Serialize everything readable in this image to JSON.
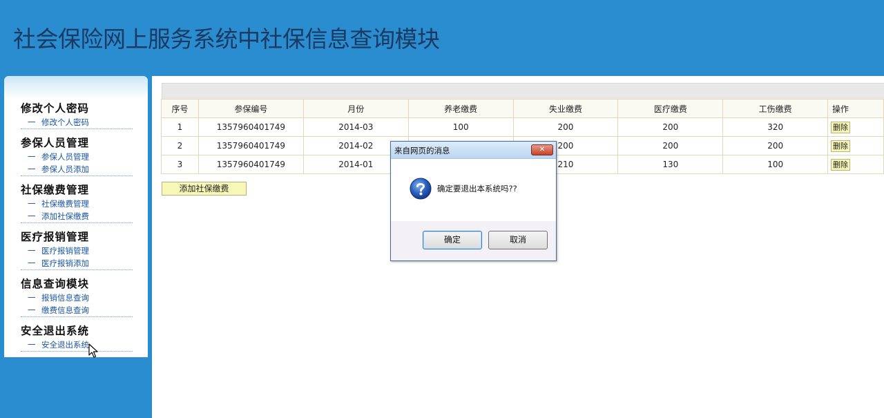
{
  "header": {
    "title": "社会保险网上服务系统中社保信息查询模块"
  },
  "sidebar": {
    "sections": [
      {
        "title": "修改个人密码",
        "links": [
          "修改个人密码"
        ]
      },
      {
        "title": "参保人员管理",
        "links": [
          "参保人员管理",
          "参保人员添加"
        ]
      },
      {
        "title": "社保缴费管理",
        "links": [
          "社保缴费管理",
          "添加社保缴费"
        ]
      },
      {
        "title": "医疗报销管理",
        "links": [
          "医疗报销管理",
          "医疗报销添加"
        ]
      },
      {
        "title": "信息查询模块",
        "links": [
          "报销信息查询",
          "缴费信息查询"
        ]
      },
      {
        "title": "安全退出系统",
        "links": [
          "安全退出系统"
        ]
      }
    ],
    "link_prefix": "一"
  },
  "table": {
    "columns": [
      "序号",
      "参保编号",
      "月份",
      "养老缴费",
      "失业缴费",
      "医疗缴费",
      "工伤缴费",
      "操作"
    ],
    "rows": [
      [
        "1",
        "1357960401749",
        "2014-03",
        "100",
        "200",
        "200",
        "320"
      ],
      [
        "2",
        "1357960401749",
        "2014-02",
        "",
        "200",
        "200",
        "200"
      ],
      [
        "3",
        "1357960401749",
        "2014-01",
        "",
        "210",
        "130",
        "100"
      ]
    ],
    "delete_label": "删除"
  },
  "add_button": {
    "label": "添加社保缴费"
  },
  "dialog": {
    "title": "来自网页的消息",
    "close_label": "✕",
    "message": "确定要退出本系统吗??",
    "ok_label": "确定",
    "cancel_label": "取消"
  }
}
